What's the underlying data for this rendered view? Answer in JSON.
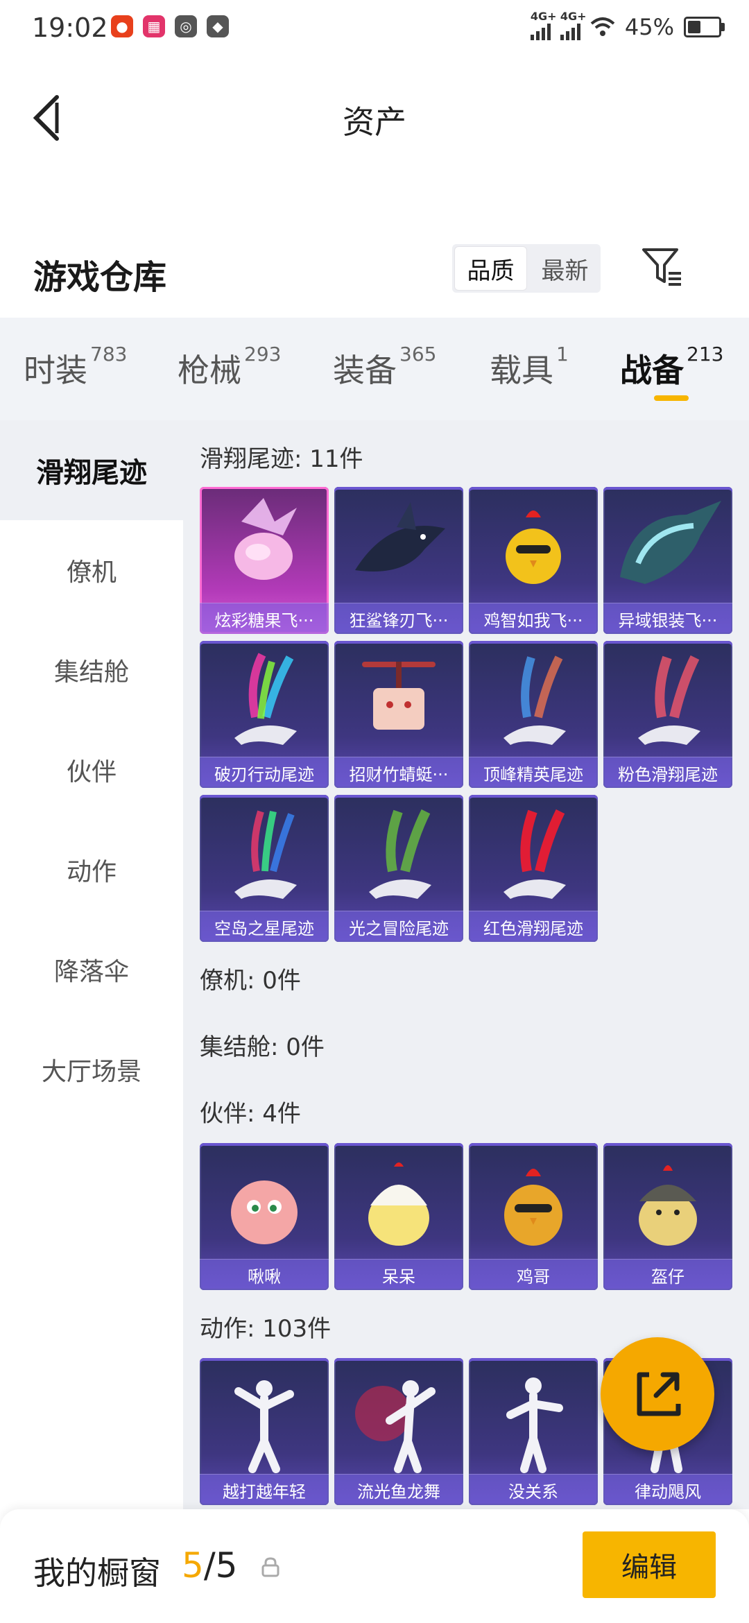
{
  "status_bar": {
    "time": "19:02",
    "network1": "4G+",
    "network2": "4G+",
    "battery": "45%"
  },
  "header": {
    "title": "资产"
  },
  "warehouse": {
    "title": "游戏仓库",
    "sort_quality": "品质",
    "sort_newest": "最新"
  },
  "tabs": [
    {
      "label": "时装",
      "count": "783"
    },
    {
      "label": "枪械",
      "count": "293"
    },
    {
      "label": "装备",
      "count": "365"
    },
    {
      "label": "载具",
      "count": "1"
    },
    {
      "label": "战备",
      "count": "213"
    }
  ],
  "sidebar": {
    "items": [
      "滑翔尾迹",
      "僚机",
      "集结舱",
      "伙伴",
      "动作",
      "降落伞",
      "大厅场景"
    ]
  },
  "sections": {
    "glide": {
      "header": "滑翔尾迹: 11件",
      "items": [
        "炫彩糖果飞···",
        "狂鲨锋刃飞···",
        "鸡智如我飞···",
        "异域银装飞···",
        "破刃行动尾迹",
        "招财竹蜻蜓···",
        "顶峰精英尾迹",
        "粉色滑翔尾迹",
        "空岛之星尾迹",
        "光之冒险尾迹",
        "红色滑翔尾迹"
      ]
    },
    "wingman": {
      "header": "僚机: 0件"
    },
    "pod": {
      "header": "集结舱: 0件"
    },
    "partner": {
      "header": "伙伴: 4件",
      "items": [
        "啾啾",
        "呆呆",
        "鸡哥",
        "盔仔"
      ]
    },
    "emote": {
      "header": "动作: 103件",
      "items": [
        "越打越年轻",
        "流光鱼龙舞",
        "没关系",
        "律动飓风"
      ]
    }
  },
  "bottom_bar": {
    "title": "我的橱窗",
    "count_current": "5",
    "count_total": "/5",
    "edit_label": "编辑"
  },
  "colors": {
    "accent": "#f7b500",
    "card_bg": "#3e3680",
    "highlight_card": "#b23ab8"
  }
}
